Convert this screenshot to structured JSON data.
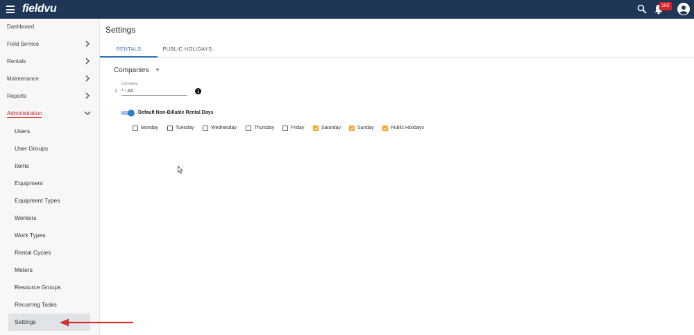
{
  "header": {
    "logo": "fieldvu",
    "notification_count": "102",
    "accent_color": "#1f3657",
    "badge_color": "#d9222a"
  },
  "sidebar": {
    "items": [
      {
        "label": "Dashboard"
      },
      {
        "label": "Field Service"
      },
      {
        "label": "Rentals"
      },
      {
        "label": "Maintenance"
      },
      {
        "label": "Reports"
      },
      {
        "label": "Administration"
      }
    ],
    "sub_items": [
      {
        "label": "Users"
      },
      {
        "label": "User Groups"
      },
      {
        "label": "Items"
      },
      {
        "label": "Equipment"
      },
      {
        "label": "Equipment Types"
      },
      {
        "label": "Workers"
      },
      {
        "label": "Work Types"
      },
      {
        "label": "Rental Cycles"
      },
      {
        "label": "Meters"
      },
      {
        "label": "Resource Groups"
      },
      {
        "label": "Recurring Tasks"
      },
      {
        "label": "Settings"
      }
    ],
    "active_item": "Administration",
    "selected_sub_item": "Settings"
  },
  "main": {
    "title": "Settings",
    "tabs": [
      {
        "label": "RENTALS",
        "active": true
      },
      {
        "label": "PUBLIC HOLIDAYS",
        "active": false
      }
    ],
    "companies": {
      "title": "Companies",
      "add_label": "+",
      "row_number": "1",
      "field_label": "Company",
      "field_value": "* - All"
    },
    "toggle": {
      "label": "Default Non-Billable Rental Days",
      "on": true
    },
    "days": [
      {
        "label": "Monday",
        "checked": false
      },
      {
        "label": "Tuesday",
        "checked": false
      },
      {
        "label": "Wednesday",
        "checked": false
      },
      {
        "label": "Thursday",
        "checked": false
      },
      {
        "label": "Friday",
        "checked": false
      },
      {
        "label": "Saturday",
        "checked": true
      },
      {
        "label": "Sunday",
        "checked": true
      },
      {
        "label": "Public Holidays",
        "checked": true
      }
    ],
    "checked_color": "#f5a623",
    "tab_active_color": "#2d6fb3"
  }
}
